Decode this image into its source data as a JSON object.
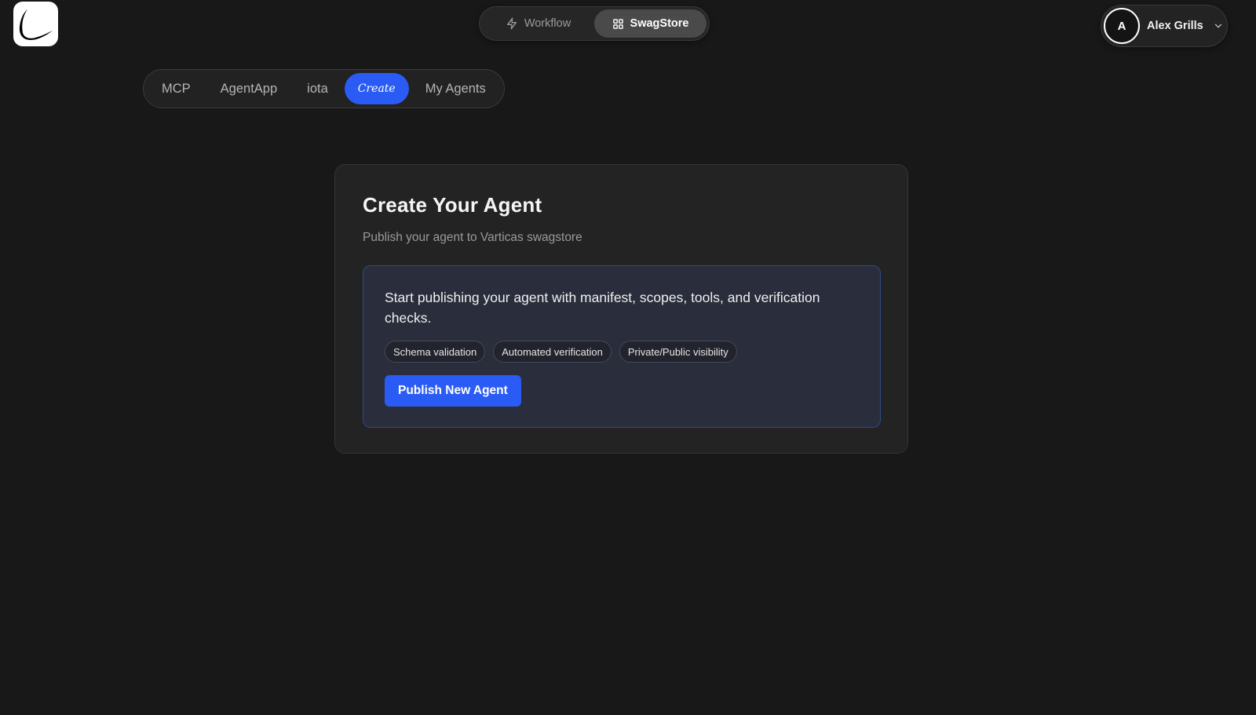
{
  "header": {
    "logo_icon": "l-swoosh-logo",
    "nav": [
      {
        "label": "Workflow",
        "icon": "lightning-icon",
        "active": false
      },
      {
        "label": "SwagStore",
        "icon": "grid-icon",
        "active": true
      }
    ],
    "user": {
      "avatar_initial": "A",
      "name": "Alex Grills",
      "menu_icon": "chevron-down-icon"
    }
  },
  "sub_tabs": [
    {
      "label": "MCP",
      "active": false
    },
    {
      "label": "AgentApp",
      "active": false
    },
    {
      "label": "iota",
      "active": false
    },
    {
      "label": "Create",
      "active": true
    },
    {
      "label": "My Agents",
      "active": false
    }
  ],
  "card": {
    "title": "Create Your Agent",
    "subtitle": "Publish your agent to Varticas swagstore",
    "panel": {
      "text": "Start publishing your agent with manifest, scopes, tools, and verification checks.",
      "tags": [
        "Schema validation",
        "Automated verification",
        "Private/Public visibility"
      ],
      "button_label": "Publish New Agent"
    }
  },
  "colors": {
    "background": "#181818",
    "accent": "#2a5cf5",
    "card": "#232323",
    "panel": "#2a2d3b",
    "panel_border": "#2f4a86"
  }
}
